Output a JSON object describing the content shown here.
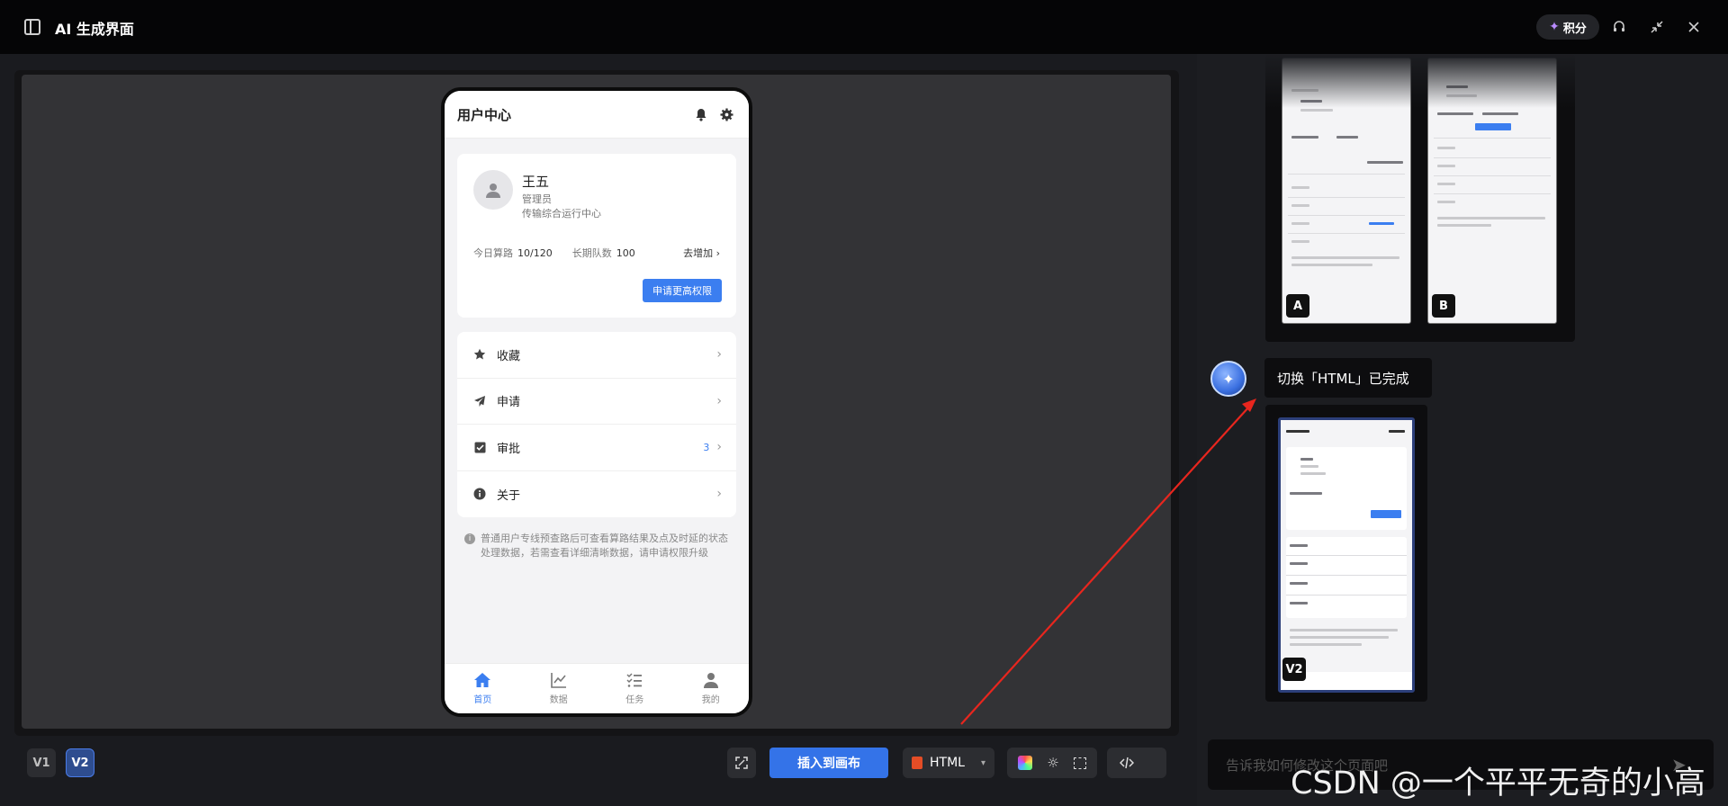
{
  "app": {
    "title": "AI 生成界面",
    "points_label": "积分"
  },
  "phone": {
    "header_title": "用户中心",
    "user": {
      "name": "王五",
      "role": "管理员",
      "department": "传输综合运行中心"
    },
    "stats": {
      "today_label": "今日算路",
      "today_value": "10/120",
      "longterm_label": "长期队数",
      "longterm_value": "100",
      "more_label": "去增加"
    },
    "apply_button": "申请更高权限",
    "menu": [
      {
        "label": "收藏",
        "icon": "star-icon",
        "badge": ""
      },
      {
        "label": "申请",
        "icon": "send-icon",
        "badge": ""
      },
      {
        "label": "审批",
        "icon": "checkbox-icon",
        "badge": "3"
      },
      {
        "label": "关于",
        "icon": "info-icon",
        "badge": ""
      }
    ],
    "notice": "普通用户专线预查路后可查看算路结果及点及时延的状态处理数据，若需查看详细清晰数据，请申请权限升级",
    "tabs": [
      {
        "label": "首页",
        "icon": "home-icon",
        "active": true
      },
      {
        "label": "数据",
        "icon": "chart-icon",
        "active": false
      },
      {
        "label": "任务",
        "icon": "tasks-icon",
        "active": false
      },
      {
        "label": "我的",
        "icon": "person-icon",
        "active": false
      }
    ]
  },
  "bottom_bar": {
    "versions": [
      "V1",
      "V2"
    ],
    "active_version": "V2",
    "insert_button": "插入到画布",
    "format_select": "HTML"
  },
  "chat": {
    "thumbnails_top": [
      {
        "badge": "A"
      },
      {
        "badge": "B"
      }
    ],
    "message": "切换「HTML」已完成",
    "result_thumbnail_badge": "V2",
    "input_placeholder": "告诉我如何修改这个页面吧"
  },
  "watermark": "CSDN @一个平平无奇的小高",
  "colors": {
    "accent": "#3b7ef0",
    "insert_button": "#3473e8",
    "annotation_arrow": "#e8261e"
  }
}
